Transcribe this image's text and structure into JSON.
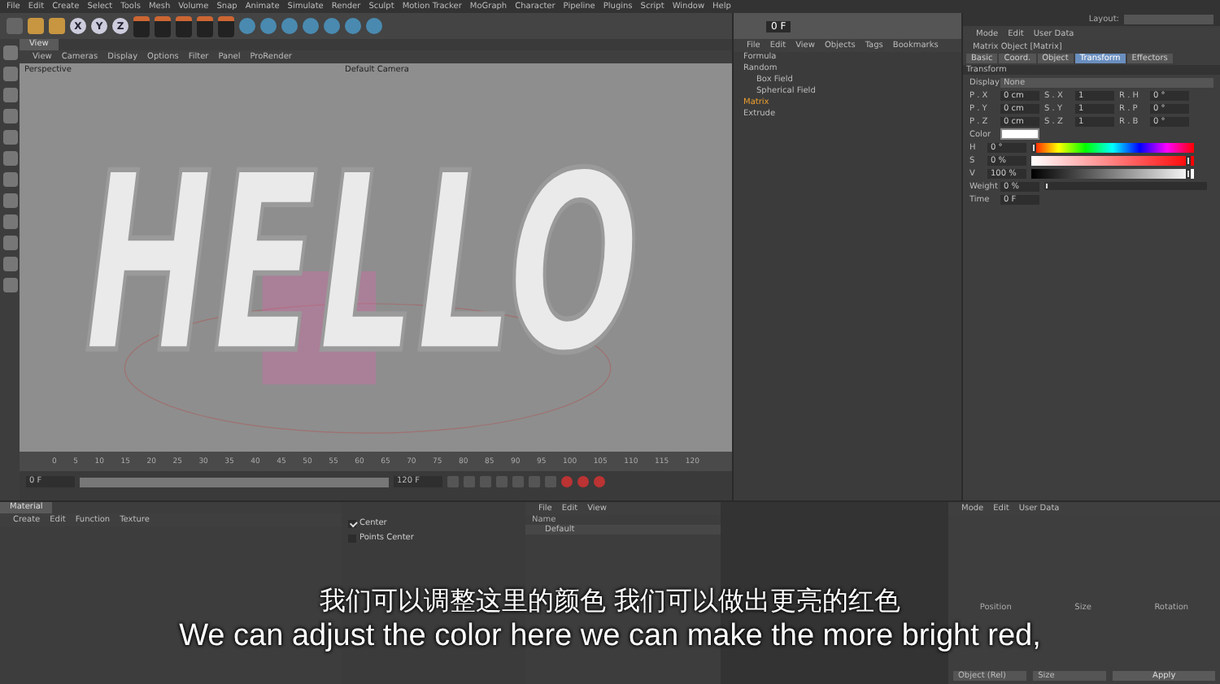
{
  "menu": [
    "File",
    "Edit",
    "Create",
    "Select",
    "Tools",
    "Mesh",
    "Volume",
    "Snap",
    "Animate",
    "Simulate",
    "Render",
    "Sculpt",
    "Motion Tracker",
    "MoGraph",
    "Character",
    "Pipeline",
    "Plugins",
    "Script",
    "Window",
    "Help"
  ],
  "axis_keys": [
    "X",
    "Y",
    "Z"
  ],
  "layout_label": "Layout:",
  "viewport": {
    "tab": {
      "label": "View",
      "selected": true
    },
    "menu": [
      "View",
      "Cameras",
      "Display",
      "Options",
      "Filter",
      "Panel",
      "ProRender"
    ],
    "projection": "Perspective",
    "camera": "Default Camera",
    "scene_text": "HELLO"
  },
  "timeline": {
    "ticks": [
      "0",
      "5",
      "10",
      "15",
      "20",
      "25",
      "30",
      "35",
      "40",
      "45",
      "50",
      "55",
      "60",
      "65",
      "70",
      "75",
      "80",
      "85",
      "90",
      "95",
      "100",
      "105",
      "110",
      "115",
      "120"
    ],
    "start": "0 F",
    "end": "120 F",
    "current": "0 F"
  },
  "objects": {
    "menu": [
      "File",
      "Edit",
      "View",
      "Objects",
      "Tags",
      "Bookmarks"
    ],
    "tree": [
      {
        "name": "Formula",
        "selected": false
      },
      {
        "name": "Random",
        "selected": false,
        "children": [
          {
            "name": "Box Field",
            "selected": false
          },
          {
            "name": "Spherical Field",
            "selected": false
          }
        ]
      },
      {
        "name": "Matrix",
        "selected": true
      },
      {
        "name": "Extrude",
        "selected": false
      }
    ]
  },
  "attributes": {
    "menu": [
      "Mode",
      "Edit",
      "User Data"
    ],
    "title": "Matrix Object [Matrix]",
    "tabs": [
      {
        "label": "Basic",
        "selected": false
      },
      {
        "label": "Coord.",
        "selected": false
      },
      {
        "label": "Object",
        "selected": false
      },
      {
        "label": "Transform",
        "selected": true
      },
      {
        "label": "Effectors",
        "selected": false
      }
    ],
    "section": "Transform",
    "display_label": "Display",
    "display_value": "None",
    "rows": [
      [
        {
          "label": "P . X",
          "value": "0 cm"
        },
        {
          "label": "S . X",
          "value": "1"
        },
        {
          "label": "R . H",
          "value": "0 °"
        }
      ],
      [
        {
          "label": "P . Y",
          "value": "0 cm"
        },
        {
          "label": "S . Y",
          "value": "1"
        },
        {
          "label": "R . P",
          "value": "0 °"
        }
      ],
      [
        {
          "label": "P . Z",
          "value": "0 cm"
        },
        {
          "label": "S . Z",
          "value": "1"
        },
        {
          "label": "R . B",
          "value": "0 °"
        }
      ]
    ],
    "color_label": "Color",
    "color": "#ffffff",
    "hsv": [
      {
        "label": "H",
        "value": "0 °",
        "kind": "hue",
        "level": 0
      },
      {
        "label": "S",
        "value": "0 %",
        "kind": "sat",
        "level": 0.95
      },
      {
        "label": "V",
        "value": "100 %",
        "kind": "val",
        "level": 0.95
      }
    ],
    "weight": {
      "label": "Weight",
      "value": "0 %",
      "level": 0
    },
    "time": {
      "label": "Time",
      "value": "0 F"
    }
  },
  "materials": {
    "tab": {
      "label": "Material",
      "selected": true
    },
    "menu": [
      "Create",
      "Edit",
      "Function",
      "Texture"
    ]
  },
  "structure": {
    "center": {
      "label": "Center",
      "checked": true
    },
    "points_center": {
      "label": "Points Center",
      "checked": false
    }
  },
  "layers": {
    "menu": [
      "File",
      "Edit",
      "View"
    ],
    "name_header": "Name",
    "row": "Default"
  },
  "attributes_lower": {
    "menu": [
      "Mode",
      "Edit",
      "User Data"
    ]
  },
  "coordinates": {
    "headers": [
      "Position",
      "Size",
      "Rotation"
    ],
    "mode": "Object (Rel)",
    "size_mode": "Size",
    "apply": "Apply"
  },
  "subtitles": {
    "zh": "我们可以调整这里的颜色 我们可以做出更亮的红色",
    "en": "We can adjust the color here we can make the more bright red,"
  }
}
